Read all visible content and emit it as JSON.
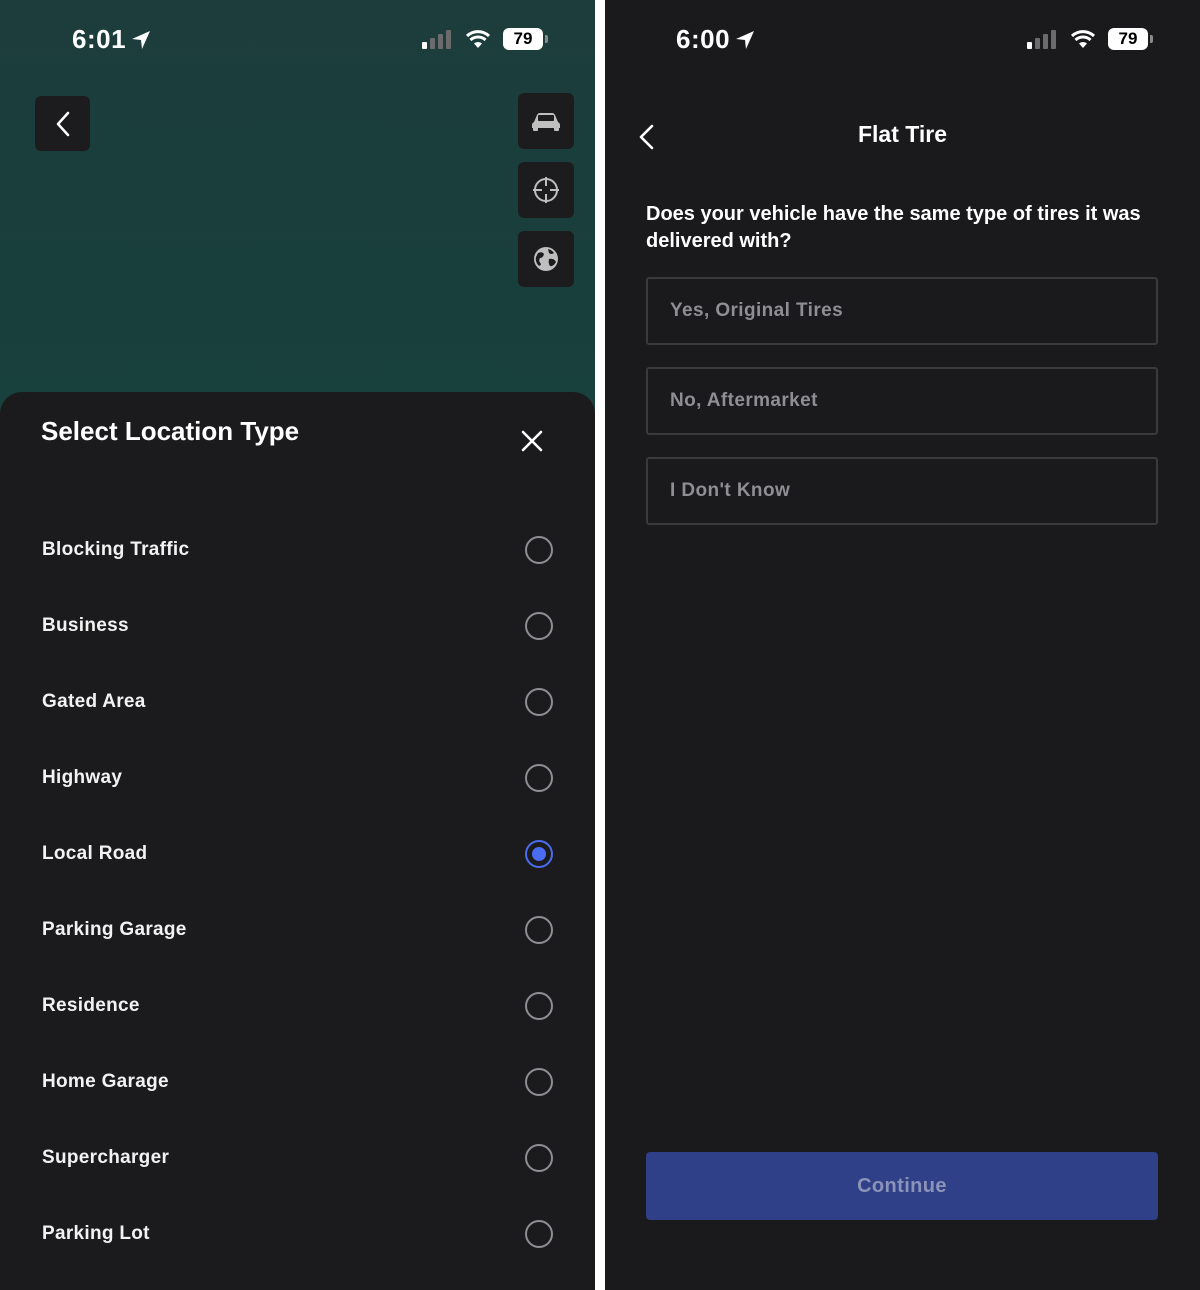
{
  "left_screen": {
    "status_bar": {
      "time": "6:01",
      "battery": "79"
    },
    "map_buttons": {
      "back_icon": "chevron-left-icon",
      "vehicle_icon": "car-icon",
      "recenter_icon": "crosshair-icon",
      "map_style_icon": "globe-icon"
    },
    "sheet": {
      "title": "Select Location Type",
      "close_icon": "close-icon",
      "selected_index": 4,
      "options": [
        {
          "label": "Blocking Traffic",
          "selected": false
        },
        {
          "label": "Business",
          "selected": false
        },
        {
          "label": "Gated Area",
          "selected": false
        },
        {
          "label": "Highway",
          "selected": false
        },
        {
          "label": "Local Road",
          "selected": true
        },
        {
          "label": "Parking Garage",
          "selected": false
        },
        {
          "label": "Residence",
          "selected": false
        },
        {
          "label": "Home Garage",
          "selected": false
        },
        {
          "label": "Supercharger",
          "selected": false
        },
        {
          "label": "Parking Lot",
          "selected": false
        }
      ]
    }
  },
  "right_screen": {
    "status_bar": {
      "time": "6:00",
      "battery": "79"
    },
    "nav": {
      "title": "Flat Tire",
      "back_icon": "chevron-left-icon"
    },
    "question": "Does your vehicle have the same type of tires it was delivered with?",
    "answers": [
      {
        "label": "Yes, Original Tires"
      },
      {
        "label": "No, Aftermarket"
      },
      {
        "label": "I Don't Know"
      }
    ],
    "continue_label": "Continue"
  },
  "colors": {
    "accent": "#4a6cf0",
    "sheet_bg": "#1b1b1d",
    "map_bg": "#17403c",
    "continue_bg": "#2f3f88"
  }
}
